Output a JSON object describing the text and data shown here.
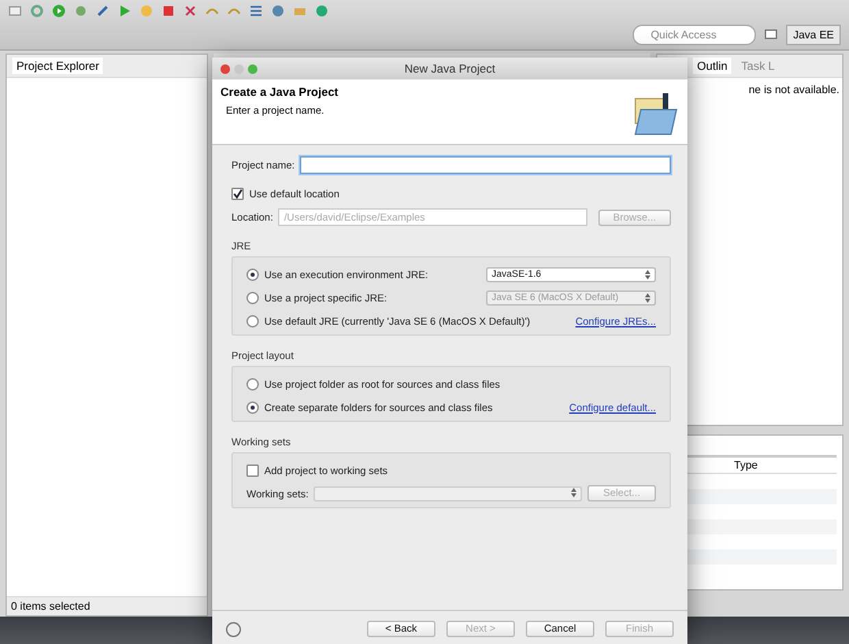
{
  "toolbar": {
    "quick_access": {
      "placeholder": "Quick Access"
    },
    "perspective": "Java EE"
  },
  "explorer": {
    "title": "Project Explorer",
    "status": "0 items selected"
  },
  "outline": {
    "tabs": [
      {
        "label": "Outlin",
        "selected": true
      },
      {
        "label": "Task L",
        "selected": false
      }
    ],
    "message": "ne is not available."
  },
  "bottom_panel": {
    "columns": [
      "Type"
    ]
  },
  "dialog": {
    "title": "New Java Project",
    "heading": "Create a Java Project",
    "subheading": "Enter a project name.",
    "project_name": {
      "label": "Project name:"
    },
    "use_default_location": {
      "label": "Use default location",
      "checked": true
    },
    "location": {
      "label": "Location:",
      "value": "/Users/david/Eclipse/Examples",
      "disabled": true
    },
    "browse": {
      "label": "Browse...",
      "disabled": true
    },
    "jre": {
      "title": "JRE",
      "options": [
        {
          "label": "Use an execution environment JRE:",
          "selected": true,
          "select": {
            "value": "JavaSE-1.6",
            "disabled": false
          }
        },
        {
          "label": "Use a project specific JRE:",
          "selected": false,
          "select": {
            "value": "Java SE 6 (MacOS X Default)",
            "disabled": true
          }
        },
        {
          "label": "Use default JRE (currently 'Java SE 6 (MacOS X Default)')",
          "selected": false,
          "link": "Configure JREs..."
        }
      ]
    },
    "layout": {
      "title": "Project layout",
      "options": [
        {
          "label": "Use project folder as root for sources and class files",
          "selected": false
        },
        {
          "label": "Create separate folders for sources and class files",
          "selected": true,
          "link": "Configure default..."
        }
      ]
    },
    "working_sets": {
      "title": "Working sets",
      "add": {
        "label": "Add project to working sets",
        "checked": false
      },
      "label": "Working sets:",
      "select_disabled": true,
      "select_button": {
        "label": "Select...",
        "disabled": true
      }
    },
    "buttons": [
      {
        "label": "< Back",
        "disabled": false
      },
      {
        "label": "Next >",
        "disabled": true
      },
      {
        "label": "Cancel",
        "disabled": false
      },
      {
        "label": "Finish",
        "disabled": true
      }
    ]
  }
}
